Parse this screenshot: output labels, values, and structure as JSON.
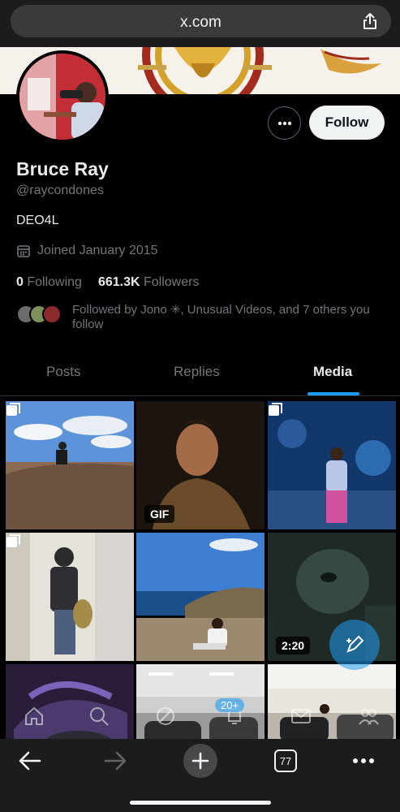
{
  "browser": {
    "url": "x.com",
    "tab_count": "77"
  },
  "profile": {
    "name": "Bruce Ray",
    "handle": "@raycondones",
    "bio": "DEO4L",
    "joined": "Joined January 2015",
    "following_count": "0",
    "following_label": "Following",
    "followers_count": "661.3K",
    "followers_label": "Followers",
    "followed_by": "Followed by Jono ✳, Unusual Videos, and 7 others you follow",
    "follow_label": "Follow"
  },
  "tabs": [
    "Posts",
    "Replies",
    "Media"
  ],
  "active_tab": "Media",
  "media": [
    {
      "kind": "photo-multi",
      "desc": "coastal-rocks"
    },
    {
      "kind": "gif",
      "badge": "GIF"
    },
    {
      "kind": "photo-multi",
      "desc": "aquarium"
    },
    {
      "kind": "photo-multi",
      "desc": "mirror-selfie"
    },
    {
      "kind": "photo",
      "desc": "ocean-cliff"
    },
    {
      "kind": "video",
      "badge": "2:20"
    },
    {
      "kind": "photo",
      "desc": "sneakers"
    },
    {
      "kind": "photo",
      "desc": "garage"
    },
    {
      "kind": "photo",
      "desc": "car-lot"
    }
  ],
  "nav_overlay": {
    "notification_count": "20+"
  },
  "colors": {
    "accent": "#1d9bf0",
    "background": "#000000",
    "muted_text": "#71767b"
  }
}
